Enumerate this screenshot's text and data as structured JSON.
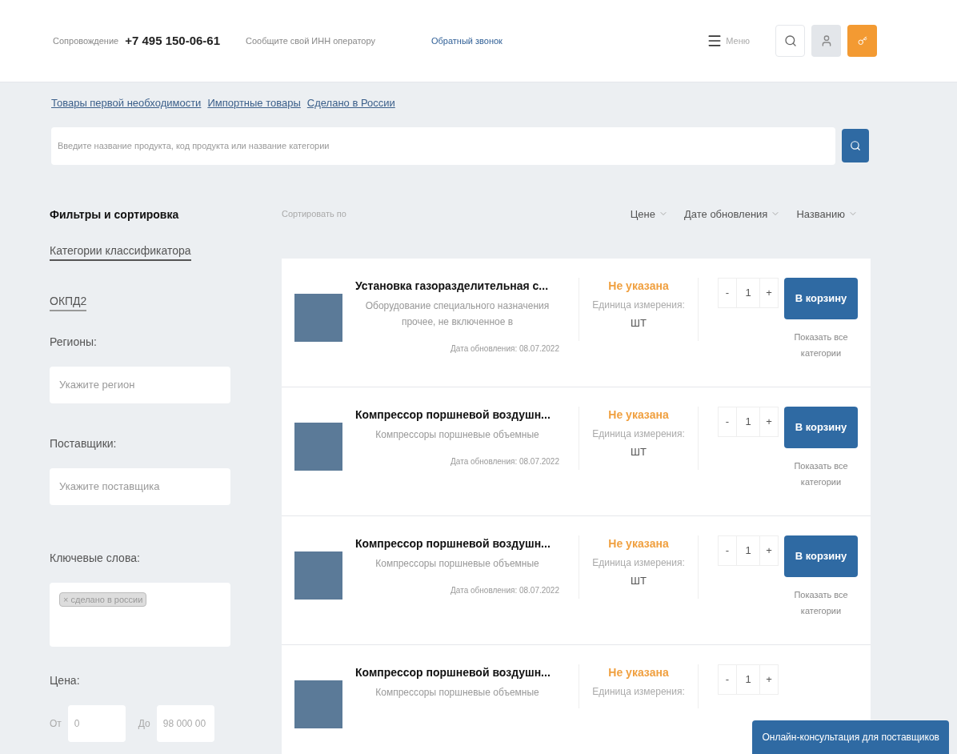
{
  "header": {
    "support_label": "Сопровождение",
    "phone": "+7 495 150-06-61",
    "inn_note": "Сообщите свой ИНН оператору",
    "callback": "Обратный звонок",
    "menu": "Меню"
  },
  "quick_links": [
    "Товары первой необходимости",
    "Импортные товары",
    "Сделано в России"
  ],
  "search": {
    "placeholder": "Введите название продукта, код продукта или название категории"
  },
  "filters": {
    "title": "Фильтры и сортировка",
    "tabs": [
      {
        "label": "Категории классификатора",
        "selected": true
      },
      {
        "label": "ОКПД2",
        "selected": false
      }
    ],
    "regions": {
      "label": "Регионы:",
      "placeholder": "Укажите регион"
    },
    "suppliers": {
      "label": "Поставщики:",
      "placeholder": "Укажите поставщика"
    },
    "keywords": {
      "label": "Ключевые слова:",
      "tags": [
        "сделано в россии"
      ],
      "remove": "×"
    },
    "price": {
      "label": "Цена:",
      "from_label": "От",
      "from": "0",
      "to_label": "До",
      "to": "98 000 00"
    }
  },
  "stepper": {
    "minus": "-",
    "plus": "+"
  },
  "sort": {
    "label": "Сортировать по",
    "options": [
      "Цене",
      "Дате обновления",
      "Названию"
    ]
  },
  "products": [
    {
      "title": "Установка газоразделительная с...",
      "description": "Оборудование специального назначения прочее, не включенное в",
      "date": "Дата обновления: 08.07.2022",
      "price": "Не указана",
      "unit_label": "Единица измерения:",
      "unit": "ШТ",
      "qty": "1",
      "button": "В корзину",
      "show_all": "Показать все категории"
    },
    {
      "title": "Компрессор поршневой воздушн...",
      "description": "Компрессоры поршневые объемные",
      "date": "Дата обновления: 08.07.2022",
      "price": "Не указана",
      "unit_label": "Единица измерения:",
      "unit": "ШТ",
      "qty": "1",
      "button": "В корзину",
      "show_all": "Показать все категории"
    },
    {
      "title": "Компрессор поршневой воздушн...",
      "description": "Компрессоры поршневые объемные",
      "date": "Дата обновления: 08.07.2022",
      "price": "Не указана",
      "unit_label": "Единица измерения:",
      "unit": "ШТ",
      "qty": "1",
      "button": "В корзину",
      "show_all": "Показать все категории"
    },
    {
      "title": "Компрессор поршневой воздушн...",
      "description": "Компрессоры поршневые объемные",
      "price": "Не указана",
      "unit_label": "Единица измерения:",
      "qty": "1"
    }
  ],
  "chat_badge": "Онлайн-консультация для поставщиков"
}
